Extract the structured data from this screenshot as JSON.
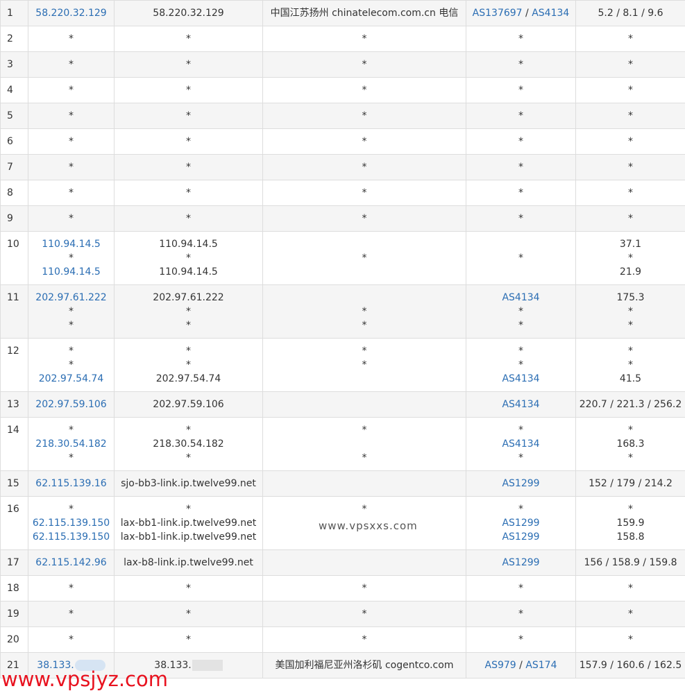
{
  "hops": [
    {
      "hop": "1",
      "ip": [
        "58.220.32.129"
      ],
      "host": [
        "58.220.32.129"
      ],
      "loc": [
        "中国江苏扬州 chinatelecom.com.cn 电信"
      ],
      "as": [
        [
          "AS137697",
          "AS4134"
        ]
      ],
      "time": [
        "5.2 / 8.1 / 9.6"
      ]
    },
    {
      "hop": "2",
      "ip": [
        "*"
      ],
      "host": [
        "*"
      ],
      "loc": [
        "*"
      ],
      "as": [
        [
          "*"
        ]
      ],
      "time": [
        "*"
      ]
    },
    {
      "hop": "3",
      "ip": [
        "*"
      ],
      "host": [
        "*"
      ],
      "loc": [
        "*"
      ],
      "as": [
        [
          "*"
        ]
      ],
      "time": [
        "*"
      ]
    },
    {
      "hop": "4",
      "ip": [
        "*"
      ],
      "host": [
        "*"
      ],
      "loc": [
        "*"
      ],
      "as": [
        [
          "*"
        ]
      ],
      "time": [
        "*"
      ]
    },
    {
      "hop": "5",
      "ip": [
        "*"
      ],
      "host": [
        "*"
      ],
      "loc": [
        "*"
      ],
      "as": [
        [
          "*"
        ]
      ],
      "time": [
        "*"
      ]
    },
    {
      "hop": "6",
      "ip": [
        "*"
      ],
      "host": [
        "*"
      ],
      "loc": [
        "*"
      ],
      "as": [
        [
          "*"
        ]
      ],
      "time": [
        "*"
      ]
    },
    {
      "hop": "7",
      "ip": [
        "*"
      ],
      "host": [
        "*"
      ],
      "loc": [
        "*"
      ],
      "as": [
        [
          "*"
        ]
      ],
      "time": [
        "*"
      ]
    },
    {
      "hop": "8",
      "ip": [
        "*"
      ],
      "host": [
        "*"
      ],
      "loc": [
        "*"
      ],
      "as": [
        [
          "*"
        ]
      ],
      "time": [
        "*"
      ]
    },
    {
      "hop": "9",
      "ip": [
        "*"
      ],
      "host": [
        "*"
      ],
      "loc": [
        "*"
      ],
      "as": [
        [
          "*"
        ]
      ],
      "time": [
        "*"
      ]
    },
    {
      "hop": "10",
      "ip": [
        "110.94.14.5",
        "*",
        "110.94.14.5"
      ],
      "host": [
        "110.94.14.5",
        "*",
        "110.94.14.5"
      ],
      "loc": [
        "",
        "*",
        ""
      ],
      "as": [
        [
          ""
        ],
        [
          "*"
        ],
        [
          ""
        ]
      ],
      "time": [
        "37.1",
        "*",
        "21.9"
      ]
    },
    {
      "hop": "11",
      "ip": [
        "202.97.61.222",
        "*",
        "*"
      ],
      "host": [
        "202.97.61.222",
        "*",
        "*"
      ],
      "loc": [
        "",
        "*",
        "*"
      ],
      "as": [
        [
          "AS4134"
        ],
        [
          "*"
        ],
        [
          "*"
        ]
      ],
      "time": [
        "175.3",
        "*",
        "*"
      ]
    },
    {
      "hop": "12",
      "ip": [
        "*",
        "*",
        "202.97.54.74"
      ],
      "host": [
        "*",
        "*",
        "202.97.54.74"
      ],
      "loc": [
        "*",
        "*",
        ""
      ],
      "as": [
        [
          "*"
        ],
        [
          "*"
        ],
        [
          "AS4134"
        ]
      ],
      "time": [
        "*",
        "*",
        "41.5"
      ]
    },
    {
      "hop": "13",
      "ip": [
        "202.97.59.106"
      ],
      "host": [
        "202.97.59.106"
      ],
      "loc": [
        ""
      ],
      "as": [
        [
          "AS4134"
        ]
      ],
      "time": [
        "220.7 / 221.3 / 256.2"
      ]
    },
    {
      "hop": "14",
      "ip": [
        "*",
        "218.30.54.182",
        "*"
      ],
      "host": [
        "*",
        "218.30.54.182",
        "*"
      ],
      "loc": [
        "*",
        "",
        "*"
      ],
      "as": [
        [
          "*"
        ],
        [
          "AS4134"
        ],
        [
          "*"
        ]
      ],
      "time": [
        "*",
        "168.3",
        "*"
      ]
    },
    {
      "hop": "15",
      "ip": [
        "62.115.139.16"
      ],
      "host": [
        "sjo-bb3-link.ip.twelve99.net"
      ],
      "loc": [
        ""
      ],
      "as": [
        [
          "AS1299"
        ]
      ],
      "time": [
        "152 / 179 / 214.2"
      ]
    },
    {
      "hop": "16",
      "ip": [
        "*",
        "62.115.139.150",
        "62.115.139.150"
      ],
      "host": [
        "*",
        "lax-bb1-link.ip.twelve99.net",
        "lax-bb1-link.ip.twelve99.net"
      ],
      "loc": [
        "*",
        "",
        ""
      ],
      "as": [
        [
          "*"
        ],
        [
          "AS1299"
        ],
        [
          "AS1299"
        ]
      ],
      "time": [
        "*",
        "159.9",
        "158.8"
      ]
    },
    {
      "hop": "17",
      "ip": [
        "62.115.142.96"
      ],
      "host": [
        "lax-b8-link.ip.twelve99.net"
      ],
      "loc": [
        ""
      ],
      "as": [
        [
          "AS1299"
        ]
      ],
      "time": [
        "156 / 158.9 / 159.8"
      ]
    },
    {
      "hop": "18",
      "ip": [
        "*"
      ],
      "host": [
        "*"
      ],
      "loc": [
        "*"
      ],
      "as": [
        [
          "*"
        ]
      ],
      "time": [
        "*"
      ]
    },
    {
      "hop": "19",
      "ip": [
        "*"
      ],
      "host": [
        "*"
      ],
      "loc": [
        "*"
      ],
      "as": [
        [
          "*"
        ]
      ],
      "time": [
        "*"
      ]
    },
    {
      "hop": "20",
      "ip": [
        "*"
      ],
      "host": [
        "*"
      ],
      "loc": [
        "*"
      ],
      "as": [
        [
          "*"
        ]
      ],
      "time": [
        "*"
      ]
    },
    {
      "hop": "21",
      "ip": [
        "38.133."
      ],
      "host": [
        "38.133."
      ],
      "loc": [
        "美国加利福尼亚州洛杉矶 cogentco.com"
      ],
      "as": [
        [
          "AS979",
          "AS174"
        ]
      ],
      "time": [
        "157.9 / 160.6 / 162.5"
      ],
      "redacted": true
    }
  ],
  "watermarks": {
    "center": "www.vpsxxs.com",
    "bottom": "www.vpsjyz.com"
  },
  "colors": {
    "link": "#2a6db3",
    "stripe": "#f5f5f5",
    "border": "#dddddd",
    "watermark_red": "#e8121f"
  }
}
